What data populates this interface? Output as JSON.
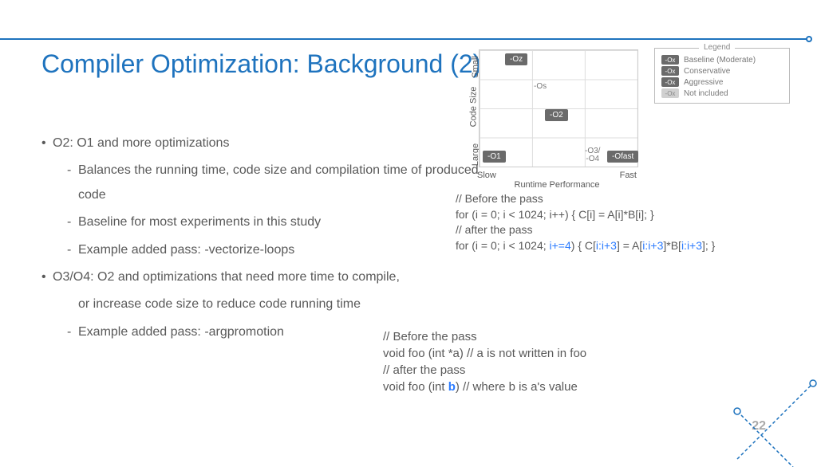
{
  "title": "Compiler Optimization: Background (2)",
  "bullets": {
    "b1a": "O2: O1 and more optimizations",
    "b2a": "Balances the running time, code size and compilation time of produced code",
    "b2b": "Baseline for most experiments in this study",
    "b2c": "Example added pass: -vectorize-loops",
    "b1b": "O3/O4: O2 and optimizations that need more time to compile,",
    "b2d": "or increase code size to reduce code running time",
    "b2e": "Example added pass: -argpromotion"
  },
  "chart_data": {
    "type": "scatter",
    "xlabel": "Runtime Performance",
    "ylabel": "Code Size",
    "x_ticks": [
      "Slow",
      "Fast"
    ],
    "y_ticks": [
      "Large",
      "Small"
    ],
    "points": [
      {
        "label": "-Oz",
        "x": 1,
        "y": 4,
        "style": "dark"
      },
      {
        "label": "-Os",
        "x": 2,
        "y": 3,
        "style": "text"
      },
      {
        "label": "-O2",
        "x": 3,
        "y": 2,
        "style": "dark"
      },
      {
        "label": "-O1",
        "x": 0,
        "y": 0,
        "style": "dark"
      },
      {
        "label": "-O3/\n-O4",
        "x": 4,
        "y": 0,
        "style": "text"
      },
      {
        "label": "-Ofast",
        "x": 5,
        "y": 0,
        "style": "dark"
      }
    ],
    "legend_title": "Legend",
    "legend": [
      {
        "sw": "-Ox",
        "style": "dark",
        "label": "Baseline (Moderate)"
      },
      {
        "sw": "-Ox",
        "style": "dark",
        "label": "Conservative"
      },
      {
        "sw": "-Ox",
        "style": "dark",
        "label": "Aggressive"
      },
      {
        "sw": "-Ox",
        "style": "light",
        "label": "Not included"
      }
    ]
  },
  "code1": {
    "l1": "// Before the pass",
    "l2a": "for (i = 0; i < 1024; i++) { C[i] = A[i]*B[i]; }",
    "l3": "// after the pass",
    "l4a": "for (i = 0; i < 1024; ",
    "l4b": "i+=4",
    "l4c": ") { C[",
    "l4d": "i:i+3",
    "l4e": "] = A[",
    "l4f": "i:i+3",
    "l4g": "]*B[",
    "l4h": "i:i+3",
    "l4i": "]; }"
  },
  "code2": {
    "l1": "// Before the pass",
    "l2": "void foo (int *a)  // a is not written in foo",
    "l3": "// after the pass",
    "l4a": "void foo (int ",
    "l4b": "b",
    "l4c": ")  // where b is a's value"
  },
  "page": "22"
}
